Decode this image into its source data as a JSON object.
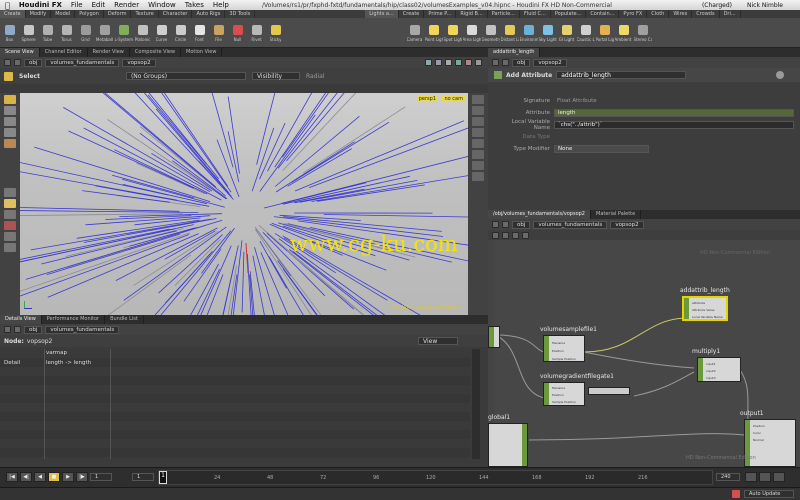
{
  "menubar": {
    "app": "Houdini FX",
    "items": [
      "File",
      "Edit",
      "Render",
      "Window",
      "Takes",
      "Help"
    ],
    "title": "/Volumes/rs1/pr/fxphd-fxtd/fundamentals/hip/class02/volumesExamples_v04.hipnc - Houdini FX HD Non-Commercial",
    "status_charged": "(Charged)",
    "user": "Nick Nimble"
  },
  "shelf": {
    "tabs_left": [
      "Create",
      "Modify",
      "Model",
      "Polygon",
      "Deform",
      "Texture",
      "Character",
      "Auto Rigs",
      "3D Tools"
    ],
    "tabs_right": [
      "Lights a...",
      "Create",
      "Prime P...",
      "Rigid B...",
      "Particle...",
      "Fluid C...",
      "Populate...",
      "Contain...",
      "Pyro FX",
      "Cloth",
      "Wires",
      "Crowds",
      "Dri..."
    ],
    "tools_left": [
      {
        "label": "Box",
        "color": "#8fa9c7"
      },
      {
        "label": "Sphere",
        "color": "#c7c7c7"
      },
      {
        "label": "Tube",
        "color": "#b0b0b0"
      },
      {
        "label": "Torus",
        "color": "#b5b5b5"
      },
      {
        "label": "Grid",
        "color": "#9b9b9b"
      },
      {
        "label": "Metaball",
        "color": "#a0a0a0"
      },
      {
        "label": "L-System",
        "color": "#7fae5b"
      },
      {
        "label": "Platonic",
        "color": "#c0c0c0"
      },
      {
        "label": "Curve",
        "color": "#cfcfcf"
      },
      {
        "label": "Circle",
        "color": "#cccccc"
      },
      {
        "label": "Font",
        "color": "#e5e5e5"
      },
      {
        "label": "File",
        "color": "#c9a35f"
      },
      {
        "label": "Null",
        "color": "#d94d4d"
      },
      {
        "label": "Rivet",
        "color": "#b8b8b8"
      },
      {
        "label": "Sticky",
        "color": "#e2c84b"
      }
    ],
    "tools_right": [
      {
        "label": "Camera",
        "color": "#a8a8a8"
      },
      {
        "label": "Point Light",
        "color": "#f0d55a"
      },
      {
        "label": "Spot Light",
        "color": "#f0d55a"
      },
      {
        "label": "Area Light",
        "color": "#d9d9d9"
      },
      {
        "label": "Geometry...",
        "color": "#c2c2c2"
      },
      {
        "label": "Distant Li...",
        "color": "#e3c95a"
      },
      {
        "label": "Environme...",
        "color": "#6db0d8"
      },
      {
        "label": "Sky Light",
        "color": "#7ec0e8"
      },
      {
        "label": "GI Light",
        "color": "#e5d070"
      },
      {
        "label": "Caustic Li...",
        "color": "#d0d0d0"
      },
      {
        "label": "Portal Light",
        "color": "#e1b24f"
      },
      {
        "label": "Ambient L...",
        "color": "#efd86a"
      },
      {
        "label": "Stereo Ca...",
        "color": "#a0a0a0"
      }
    ]
  },
  "left_pane": {
    "tabs": [
      "Scene View",
      "Channel Editor",
      "Render View",
      "Composite View",
      "Motion View"
    ],
    "path": {
      "obj": "obj",
      "node": "volumes_fundamentals",
      "sub": "vopsop2"
    },
    "select_label": "Select",
    "group_dropdown": "(No Groups)",
    "visibility": "Visibility",
    "radial": "Radial",
    "persp": "persp1",
    "cam": "no cam",
    "watermark": "HD Non-Commercial Edition"
  },
  "params": {
    "tabs": [
      "addattrib_length"
    ],
    "path": {
      "obj": "obj",
      "sub": "vopsop2"
    },
    "header_label": "Add Attribute",
    "node_name": "addattrib_length",
    "rows": [
      {
        "label": "Signature",
        "value": "Float Attribute"
      },
      {
        "label": "Attribute",
        "value": "length"
      },
      {
        "label": "Local Variable Name",
        "value": "`chs(\"../attrib\")`"
      },
      {
        "label": "Data Type",
        "value": ""
      },
      {
        "label": "Type Modifier",
        "value": "None"
      }
    ]
  },
  "network": {
    "tabs": [
      "/obj/volumes_fundamentals/vopsop2",
      "Material Palette"
    ],
    "path": {
      "obj": "obj",
      "node": "volumes_fundamentals",
      "sub": "vopsop2"
    },
    "nodes": {
      "addattrib": "addattrib_length",
      "volsample": "volumesamplefile1",
      "volgrad": "volumegradientfilegate1",
      "multiply": "multiply1",
      "output": "output1",
      "global": "global1"
    },
    "port_labels": {
      "volsample": [
        "filename",
        "Position",
        "Sample Position"
      ],
      "volgrad": [
        "filename",
        "Position",
        "Sample Position"
      ],
      "addattrib": [
        "attribute",
        "Attribute Value",
        "Local Variable Name"
      ],
      "multiply": [
        "input1",
        "input2",
        "input3"
      ],
      "output": [
        "Position",
        "Color",
        "Normal"
      ]
    },
    "watermark": "HD Non-Commercial Edition",
    "watermark2": "HD Non-Commercial Edition"
  },
  "details": {
    "tabs": [
      "Details View",
      "Performance Monitor",
      "Bundle List"
    ],
    "path": {
      "obj": "obj",
      "node": "volumes_fundamentals"
    },
    "node_label": "Node:",
    "node_value": "vopsop2",
    "view_label": "View",
    "col_header": "varmap",
    "row_label": "Detail",
    "row_value": "length -> length"
  },
  "timeline": {
    "frame": "1",
    "start": "1",
    "end_field": "1",
    "ticks": [
      "1",
      "24",
      "48",
      "72",
      "96",
      "120",
      "144",
      "168",
      "192",
      "216"
    ],
    "end": "240"
  },
  "statusbar": {
    "auto_update": "Auto Update"
  },
  "watermark_site": "www.cg-ku.com",
  "accent": "#f5e400"
}
